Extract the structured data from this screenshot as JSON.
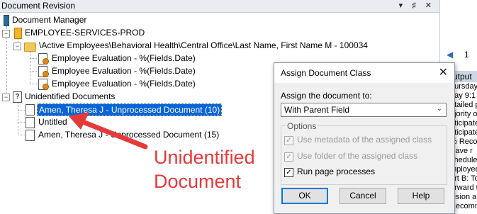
{
  "panel": {
    "title": "Document Revision",
    "title_buttons": "▾ ♯ ✕"
  },
  "tree": {
    "root_label": "Document Manager",
    "db_label": "EMPLOYEE-SERVICES-PROD",
    "folder_label": "\\Active Employees\\Behavioral Health\\Central Office\\Last Name, First Name M - 100034",
    "eval_docs": [
      "Employee Evaluation - %(Fields.Date)",
      "Employee Evaluation - %(Fields.Date)",
      "Employee Evaluation - %(Fields.Date)"
    ],
    "unidentified_label": "Unidentified Documents",
    "unidentified_docs": [
      "Amen, Theresa J - Unprocessed Document (10)",
      "Untitled",
      "Amen, Theresa J - Unprocessed Document (15)"
    ]
  },
  "side": {
    "page_number": "1",
    "output_title": "utput",
    "lines": [
      "hursday",
      "day 9:1",
      "etailed p",
      "ajority of",
      "nticipate",
      "nticipate",
      "% Recor",
      "lliave r",
      "chedule",
      "mployee",
      "art B: To",
      "orward to",
      "cision a",
      "Recomm"
    ]
  },
  "dialog": {
    "title": "Assign Document Class",
    "close": "✕",
    "assign_label": "Assign the document to:",
    "select_value": "With Parent Field",
    "options_label": "Options",
    "options": [
      {
        "label": "Use metadata of the assigned class",
        "checked": true,
        "enabled": false
      },
      {
        "label": "Use folder of the assigned class",
        "checked": true,
        "enabled": false
      },
      {
        "label": "Run page processes",
        "checked": true,
        "enabled": true
      }
    ],
    "ok": "OK",
    "cancel": "Cancel",
    "help": "Help"
  },
  "annotation": {
    "line1": "Unidentified",
    "line2": "Document",
    "color": "#e63a3a"
  }
}
